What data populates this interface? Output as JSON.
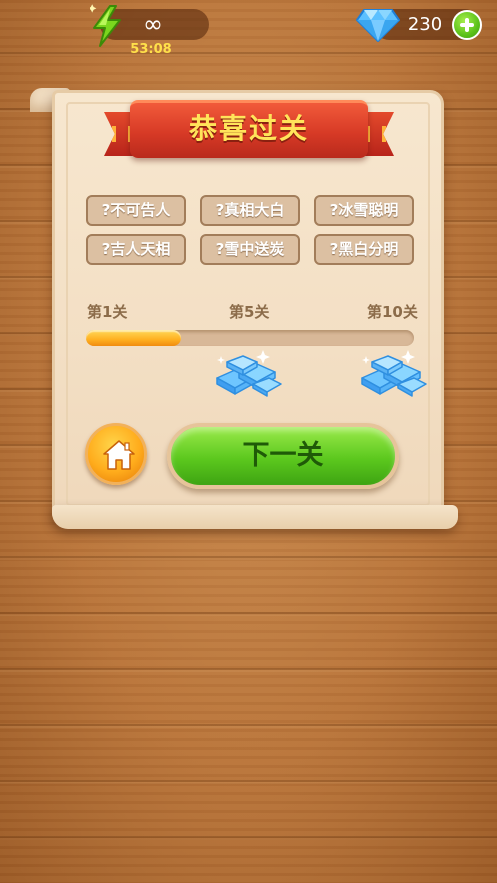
{
  "top_bar": {
    "energy": {
      "value": "∞",
      "timer": "53:08",
      "icon": "lightning-icon"
    },
    "gems": {
      "value": "230",
      "icon": "diamond-icon",
      "add_icon": "plus-icon"
    }
  },
  "panel": {
    "title": "恭喜过关",
    "idioms": [
      "?不可告人",
      "?真相大白",
      "?冰雪聪明",
      "?吉人天相",
      "?雪中送炭",
      "?黑白分明"
    ],
    "progress": {
      "levels": [
        "第1关",
        "第5关",
        "第10关"
      ],
      "fraction": 0.29,
      "rewards": [
        "gem-pile-icon",
        "gem-pile-icon"
      ]
    },
    "home_icon": "home-icon",
    "next_label": "下一关"
  },
  "colors": {
    "title_text": "#ffe45a",
    "ribbon": "#d73a26",
    "progress_fill": "#ffb020",
    "next_button": "#5cc81e",
    "home_button": "#ffac1c"
  }
}
